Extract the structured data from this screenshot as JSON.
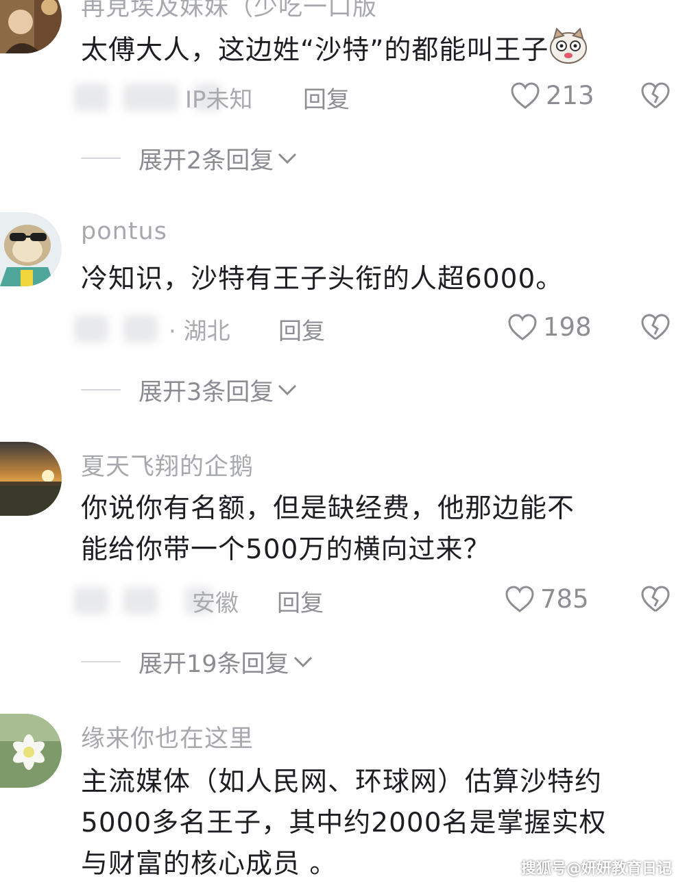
{
  "comments": [
    {
      "username": "再見埃及妹妹（少吃一口版",
      "text": "太傅大人，这边姓“沙特”的都能叫王子",
      "location": "IP未知",
      "reply_label": "回复",
      "likes": "213",
      "expand_label": "展开2条回复"
    },
    {
      "username": "pontus",
      "text": "冷知识，沙特有王子头衔的人超6000。",
      "location": "· 湖北",
      "reply_label": "回复",
      "likes": "198",
      "expand_label": "展开3条回复"
    },
    {
      "username": "夏天飞翔的企鹅",
      "text_line1": "你说你有名额，但是缺经费，他那边能不",
      "text_line2": "能给你带一个500万的横向过来？",
      "location": "安徽",
      "reply_label": "回复",
      "likes": "785",
      "expand_label": "展开19条回复"
    },
    {
      "username": "缘来你也在这里",
      "text_line1": "主流媒体（如人民网、环球网）估算沙特约",
      "text_line2": "5000多名王子，其中约2000名是掌握实权",
      "text_line3": "与财富的核心成员 。"
    }
  ],
  "watermark": "搜狐号@妍妍教育日记",
  "icons": {
    "like": "heart-outline-icon",
    "dislike": "broken-heart-icon",
    "expand": "chevron-down-icon"
  },
  "colors": {
    "meta_text": "#a1a3a8",
    "body_text": "#1d1e22"
  }
}
